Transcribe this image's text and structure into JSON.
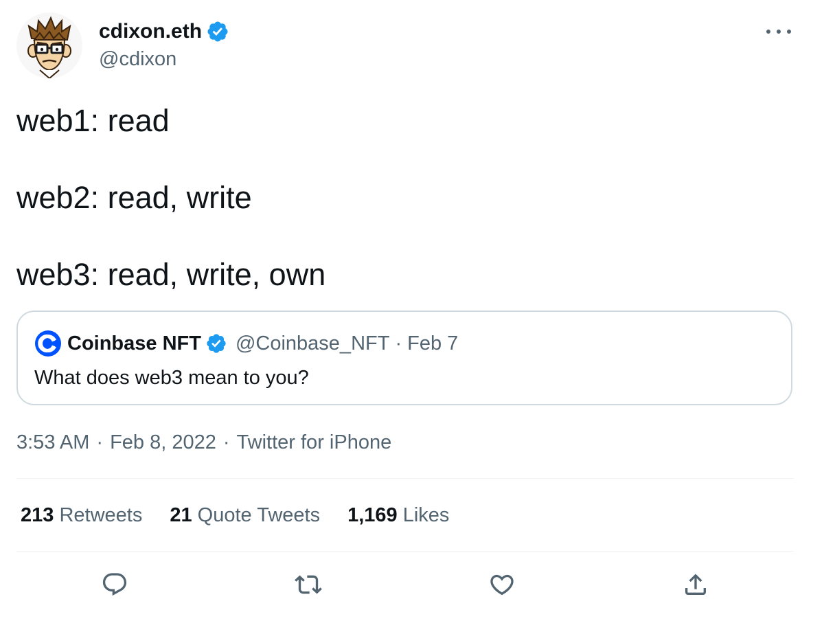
{
  "author": {
    "display_name": "cdixon.eth",
    "handle": "@cdixon",
    "verified": true
  },
  "tweet": {
    "lines": [
      "web1: read",
      "web2: read, write",
      "web3: read, write, own"
    ]
  },
  "quote": {
    "display_name": "Coinbase NFT",
    "handle": "@Coinbase_NFT",
    "separator": "·",
    "date": "Feb 7",
    "text": "What does web3 mean to you?"
  },
  "meta": {
    "time": "3:53 AM",
    "separator": "·",
    "date": "Feb 8, 2022",
    "source": "Twitter for iPhone"
  },
  "stats": {
    "retweets_count": "213",
    "retweets_label": "Retweets",
    "quotes_count": "21",
    "quotes_label": "Quote Tweets",
    "likes_count": "1,169",
    "likes_label": "Likes"
  },
  "icons": {
    "more": "more-horizontal-icon",
    "reply": "reply-icon",
    "retweet": "retweet-icon",
    "like": "heart-icon",
    "share": "share-icon",
    "verified": "verified-badge-icon"
  },
  "colors": {
    "text_primary": "#0f1419",
    "text_secondary": "#536471",
    "verified_blue": "#1d9bf0",
    "coinbase_blue": "#0052ff",
    "border": "#cfd9de"
  }
}
